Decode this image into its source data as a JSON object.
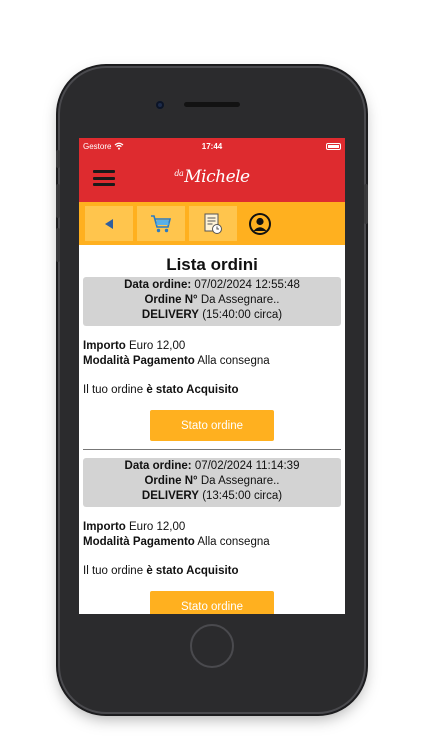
{
  "status_bar": {
    "carrier": "Gestore",
    "time": "17:44"
  },
  "header": {
    "logo_small": "da",
    "logo_main": "Michele"
  },
  "toolbar": {
    "icons": [
      "back-arrow-icon",
      "cart-icon",
      "order-history-icon",
      "user-icon"
    ]
  },
  "page": {
    "title": "Lista ordini"
  },
  "orders": [
    {
      "date_label": "Data ordine:",
      "date_value": "07/02/2024 12:55:48",
      "number_label": "Ordine N°",
      "number_value": "Da Assegnare..",
      "delivery_label": "DELIVERY",
      "delivery_value": "(15:40:00 circa)",
      "amount_label": "Importo",
      "amount_value": "Euro 12,00",
      "payment_label": "Modalità Pagamento",
      "payment_value": "Alla consegna",
      "status_prefix": "Il tuo ordine",
      "status_value": "è stato Acquisito",
      "button_label": "Stato ordine"
    },
    {
      "date_label": "Data ordine:",
      "date_value": "07/02/2024 11:14:39",
      "number_label": "Ordine N°",
      "number_value": "Da Assegnare..",
      "delivery_label": "DELIVERY",
      "delivery_value": "(13:45:00 circa)",
      "amount_label": "Importo",
      "amount_value": "Euro 12,00",
      "payment_label": "Modalità Pagamento",
      "payment_value": "Alla consegna",
      "status_prefix": "Il tuo ordine",
      "status_value": "è stato Acquisito",
      "button_label": "Stato ordine"
    }
  ],
  "colors": {
    "brand_red": "#de2b2f",
    "accent_orange": "#ffb01f",
    "card_gray": "#d3d3d3"
  }
}
